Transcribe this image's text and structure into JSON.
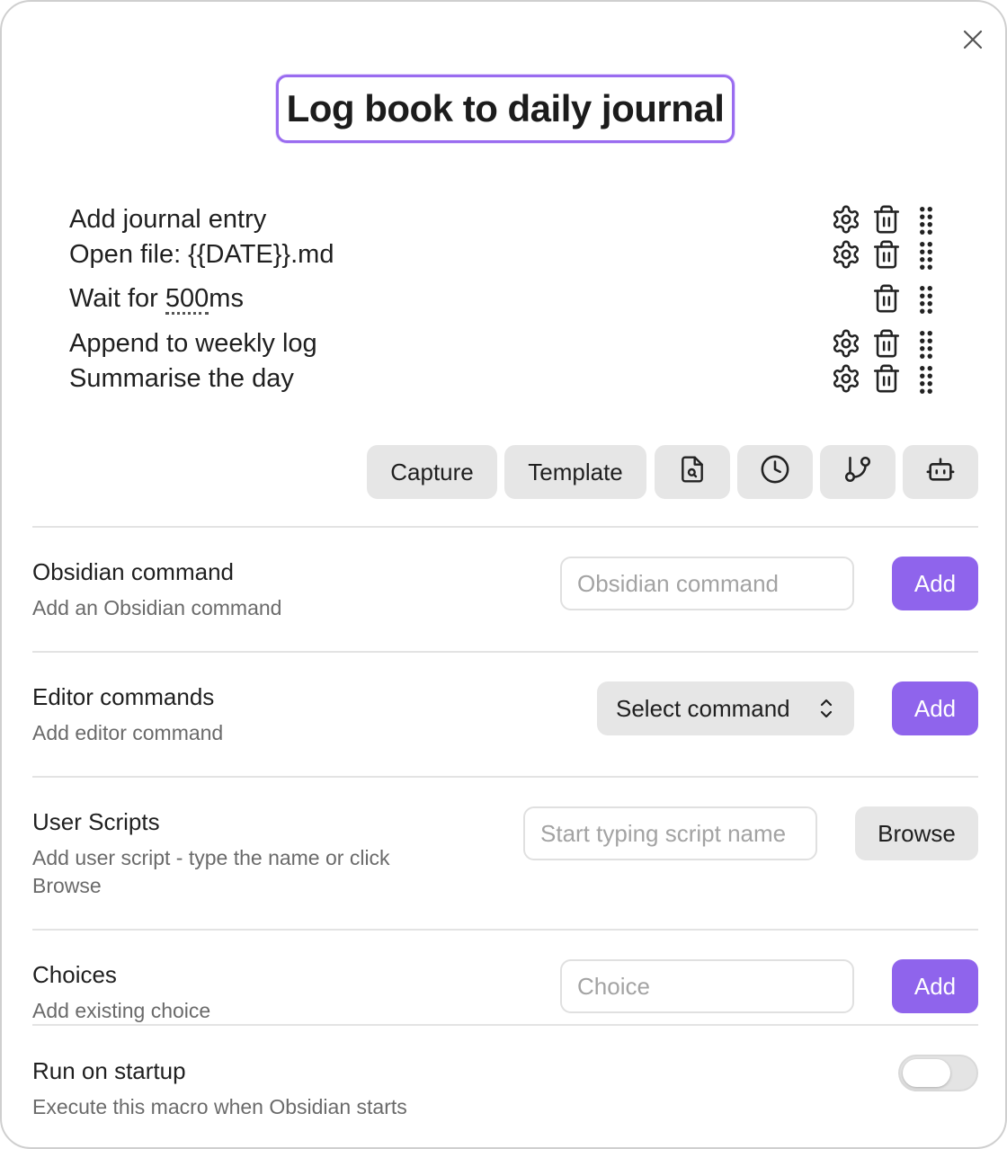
{
  "modal": {
    "title": "Log book to daily journal",
    "close_icon": "close-icon"
  },
  "commands": [
    {
      "label": "Add journal entry",
      "icons": [
        "gear-icon",
        "trash-icon",
        "drag-handle-icon"
      ]
    },
    {
      "label": "Open file: {{DATE}}.md",
      "icons": [
        "gear-icon",
        "trash-icon",
        "drag-handle-icon"
      ]
    },
    {
      "label_prefix": "Wait for ",
      "label_value": "500",
      "label_suffix": "ms",
      "icons": [
        "trash-icon",
        "drag-handle-icon"
      ]
    },
    {
      "label": "Append to weekly log",
      "icons": [
        "gear-icon",
        "trash-icon",
        "drag-handle-icon"
      ]
    },
    {
      "label": "Summarise the day",
      "icons": [
        "gear-icon",
        "trash-icon",
        "drag-handle-icon"
      ]
    }
  ],
  "toolbar": {
    "capture_label": "Capture",
    "template_label": "Template",
    "icon_buttons": [
      "file-search-icon",
      "clock-icon",
      "git-branch-icon",
      "bot-icon"
    ]
  },
  "settings": {
    "obsidian_command": {
      "name": "Obsidian command",
      "desc": "Add an Obsidian command",
      "placeholder": "Obsidian command",
      "button": "Add"
    },
    "editor_commands": {
      "name": "Editor commands",
      "desc": "Add editor command",
      "selected": "Select command",
      "button": "Add"
    },
    "user_scripts": {
      "name": "User Scripts",
      "desc": "Add user script - type the name or click Browse",
      "placeholder": "Start typing script name",
      "button": "Browse"
    },
    "choices": {
      "name": "Choices",
      "desc": "Add existing choice",
      "placeholder": "Choice",
      "button": "Add"
    },
    "run_on_startup": {
      "name": "Run on startup",
      "desc": "Execute this macro when Obsidian starts",
      "enabled": false
    }
  },
  "colors": {
    "accent": "#8f64ec",
    "title_border": "#9a6cf0",
    "button_bg": "#e6e6e6"
  }
}
